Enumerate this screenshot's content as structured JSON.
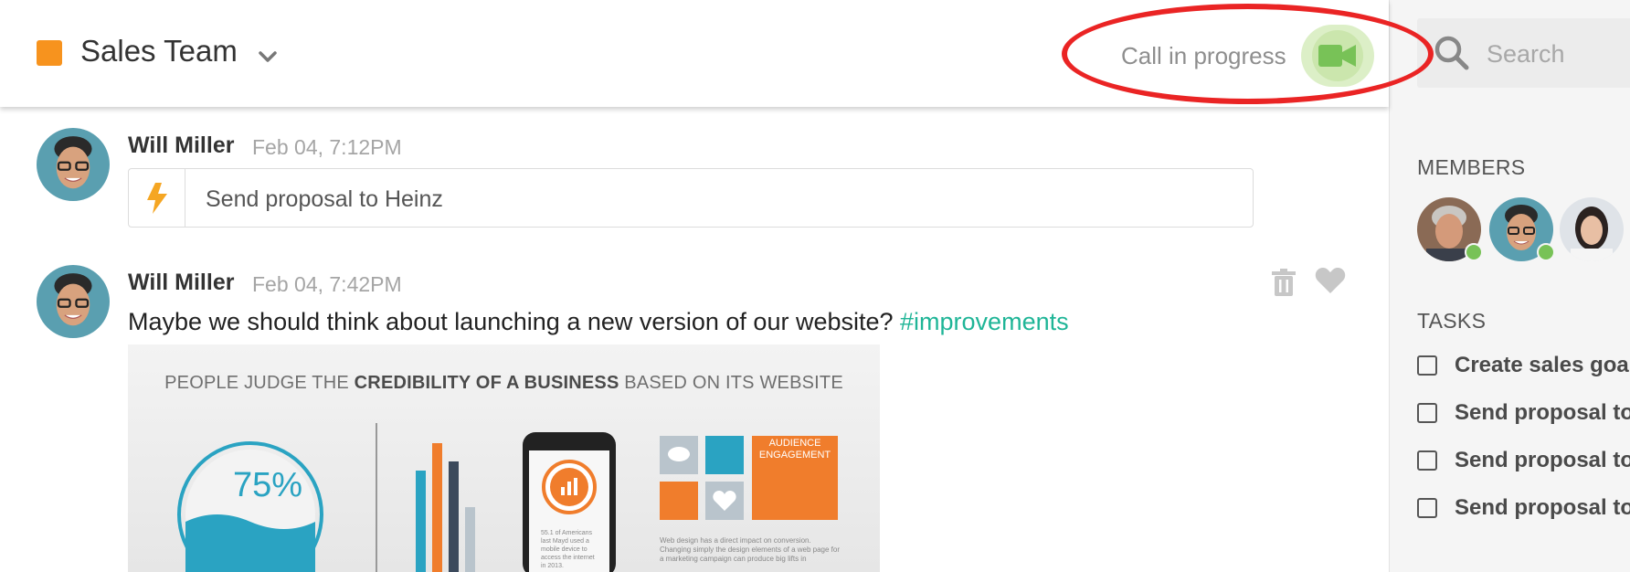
{
  "header": {
    "channel_name": "Sales Team",
    "channel_color": "#f7931e",
    "dropdown_icon": "chevron-down-icon",
    "call_status": "Call in progress",
    "call_icon": "video-camera-icon",
    "call_color": "#78c257",
    "highlight_color": "#ea2424"
  },
  "sidebar": {
    "search_placeholder": "Search",
    "members_heading": "MEMBERS",
    "members": [
      {
        "avatar": "avatar-man-gray-hair",
        "online": true
      },
      {
        "avatar": "avatar-will-miller",
        "online": true
      },
      {
        "avatar": "avatar-woman",
        "online": false
      }
    ],
    "tasks_heading": "TASKS",
    "tasks": [
      {
        "label": "Create sales goa",
        "checked": false
      },
      {
        "label": "Send proposal to",
        "checked": false
      },
      {
        "label": "Send proposal to",
        "checked": false
      },
      {
        "label": "Send proposal to",
        "checked": false
      }
    ]
  },
  "messages": [
    {
      "author": "Will Miller",
      "time": "Feb 04, 7:12PM",
      "task_icon": "lightning-bolt-icon",
      "task_text": "Send proposal to Heinz"
    },
    {
      "author": "Will Miller",
      "time": "Feb 04, 7:42PM",
      "text": "Maybe we should think about launching a new version of our website?",
      "hashtag": "#improvements",
      "hashtag_color": "#1fb597",
      "actions": [
        "trash-icon",
        "heart-icon"
      ],
      "attachment": {
        "title_pre": "PEOPLE JUDGE THE",
        "title_bold": "CREDIBILITY OF A BUSINESS",
        "title_post": "BASED ON ITS WEBSITE",
        "percent": "75%",
        "audience_label": "AUDIENCE ENGAGEMENT",
        "phone_caption": "55.1 of Americans last Mayd used a mobile device to access the internet in 2013.",
        "footer_text": "Web design has a direct impact on conversion. Changing simply the design elements of a web page for a marketing campaign can produce big lifts in"
      }
    }
  ]
}
